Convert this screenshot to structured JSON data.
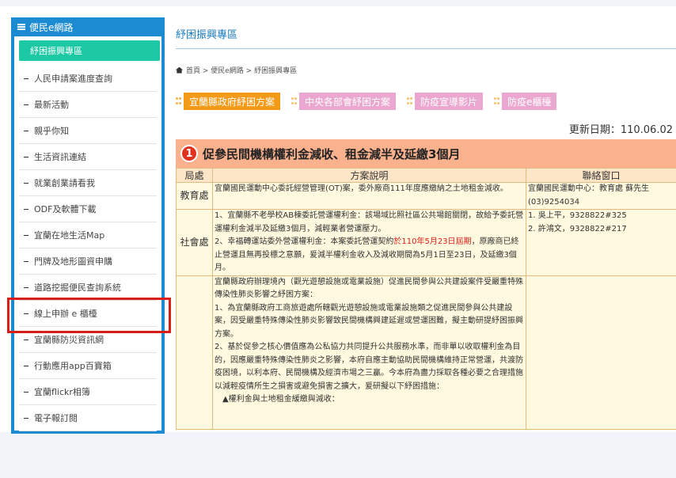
{
  "sidebar": {
    "title": "便民e網路",
    "active_item": "紓困振興專區",
    "items": [
      "人民申請案進度查詢",
      "最新活動",
      "親乎你知",
      "生活資訊連結",
      "就業創業請看我",
      "ODF及軟體下載",
      "宜蘭在地生活Map",
      "門牌及地形圖資申購",
      "道路挖掘便民查詢系統",
      "線上申辦 e 櫃檯",
      "宜蘭縣防災資訊網",
      "行動應用app百寶箱",
      "宜蘭flickr相簿",
      "電子報訂閱"
    ]
  },
  "main": {
    "title": "紓困振興專區",
    "breadcrumb": "首頁 > 便民e網路 > 紓困振興專區",
    "tabs": [
      "宜蘭縣政府紓困方案",
      "中央各部會紓困方案",
      "防疫宣導影片",
      "防疫e櫃檯"
    ],
    "updated": "更新日期：110.06.02",
    "section_num": "1",
    "section_title": "促參民間機構權利金減收、租金減半及延繳3個月",
    "table": {
      "headers": [
        "局處",
        "方案說明",
        "聯絡窗口"
      ],
      "rows": [
        {
          "dept": "教育處",
          "desc": "宜蘭國民運動中心委託經營管理(OT)案，委外廠商111年度應繳納之土地租金減收。",
          "contact": "宜蘭國民運動中心：教育處 蘇先生(03)9254034"
        },
        {
          "dept": "社會處",
          "desc_1": "1、宜蘭縣不老學校AB棟委託營運權利金：該場域比照社區公共場館關閉，故給予委託營運權利金減半及延繳3個月，減輕業者營運壓力。",
          "desc_2a": "2、幸福轉運站委外營運權利金：本案委託營運契約",
          "desc_2red": "於110年5月23日屆期",
          "desc_2b": "，原廠商已終止營運且無再投標之意願，爰減半權利金收入及減收期間為5月1日至23日，及延繳3個月。",
          "contact_1": "1. 吳上平，9328822#325",
          "contact_2": "2. 許鴻文，9328822#217"
        },
        {
          "dept": "",
          "desc_1": "宜蘭縣政府辦理境內（觀光遊憩設施或電業設施）促進民間參與公共建設案件受嚴重特殊傳染性肺炎影響之紓困方案：",
          "desc_2": "1、為宜蘭縣政府工商旅遊處所轄觀光遊憩設施或電業設施類之促進民間參與公共建設案，因受嚴重特殊傳染性肺炎影響致民間機構興建延遲或營運困難，擬主動研提紓困振興方案。",
          "desc_3": "2、基於促參之核心價值應為公私協力共同提升公共服務水準，而非單以收取權利金為目的，因應嚴重特殊傳染性肺炎之影響，本府自應主動協助民間機構維持正常營運，共渡防疫困境，以利本府、民間機構及經濟市場之三贏。今本府為盡力採取各種必要之合理措施以減輕疫情所生之損害或避免損害之擴大，爰研擬以下紓困措施：",
          "desc_4": "▲權利金與土地租金緩繳與減收："
        }
      ]
    }
  },
  "colors": {
    "sidebar_blue": "#1d8bd1",
    "active_green": "#1dc9a4",
    "tab_orange": "#f39a18",
    "tab_pink": "#eaa7cf",
    "banner_salmon": "#f9b18e",
    "highlight_red": "#d91e18"
  }
}
